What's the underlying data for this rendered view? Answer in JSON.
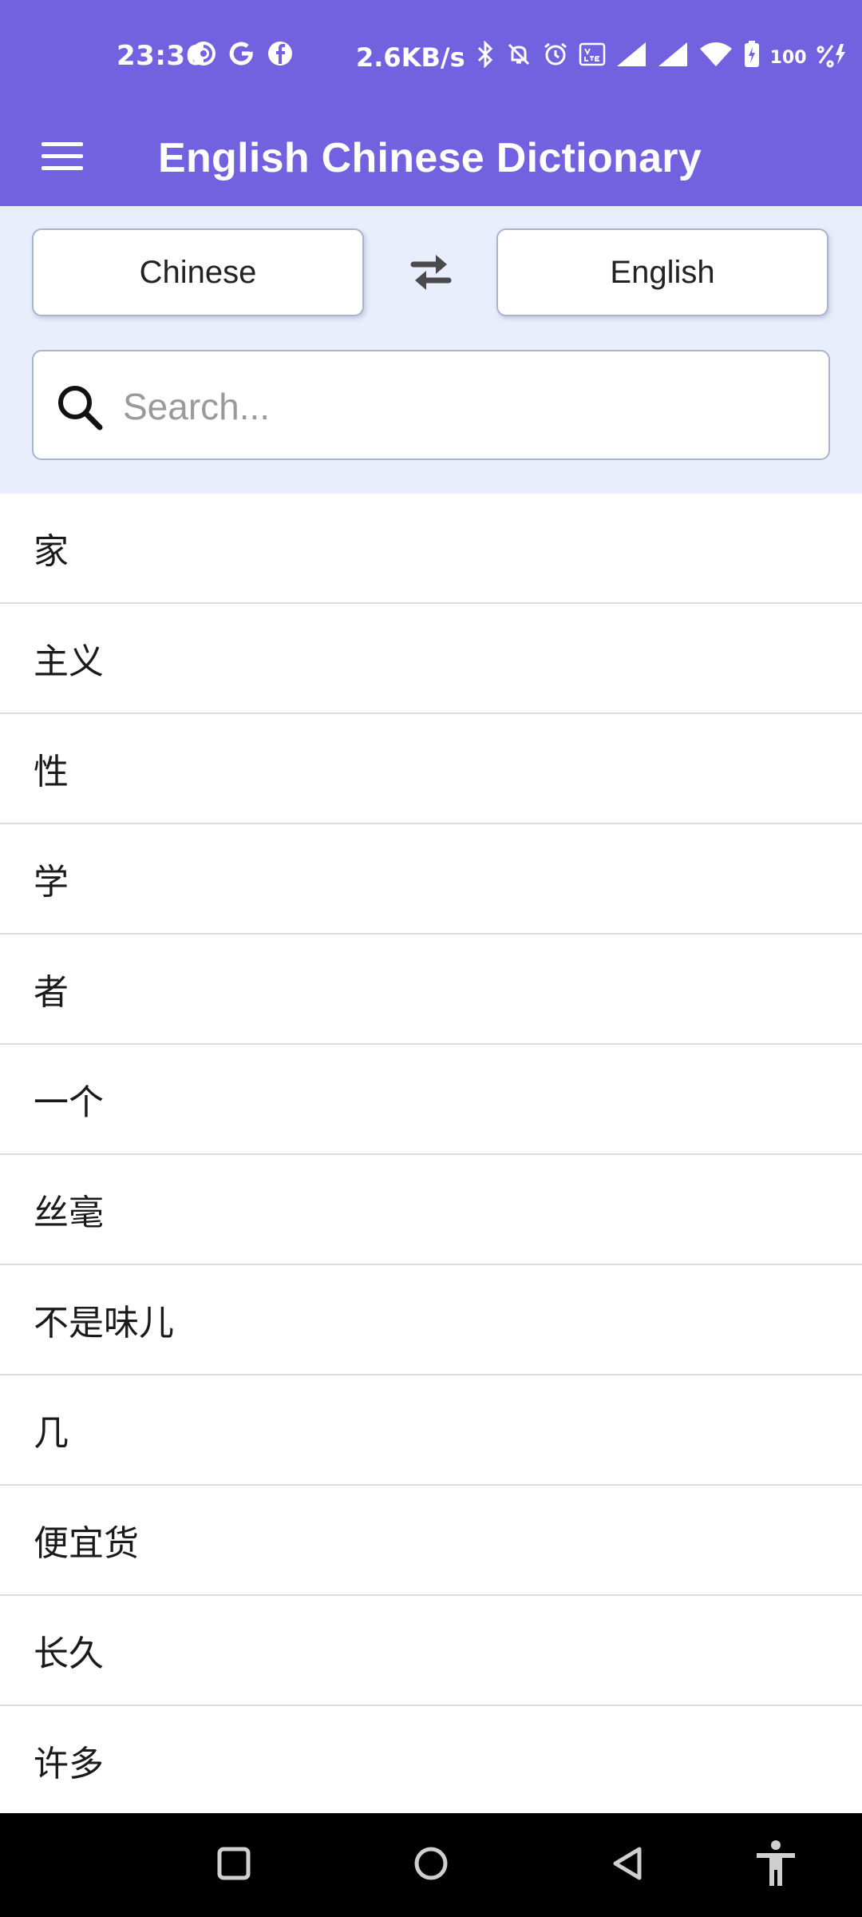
{
  "status_bar": {
    "time": "23:36",
    "net_speed": "2.6KB/s",
    "battery": "100",
    "left_icons": [
      "pocket-casts-icon",
      "google-icon",
      "facebook-icon"
    ],
    "right_icons": [
      "bluetooth-icon",
      "mute-icon",
      "alarm-icon",
      "volte-icon",
      "signal-icon",
      "signal-icon",
      "wifi-icon",
      "battery-charging-icon",
      "speed-icon"
    ]
  },
  "app_bar": {
    "title": "English Chinese Dictionary",
    "menu_icon": "hamburger-menu-icon",
    "color": "#7362E0"
  },
  "language": {
    "from": "Chinese",
    "to": "English",
    "swap_icon": "swap-arrows-icon"
  },
  "search": {
    "placeholder": "Search...",
    "value": ""
  },
  "words": [
    "家",
    "主义",
    "性",
    "学",
    "者",
    "一个",
    "丝毫",
    "不是味儿",
    "几",
    "便宜货",
    "长久",
    "许多"
  ],
  "nav_bar": {
    "icons": [
      "recents-icon",
      "home-icon",
      "back-icon",
      "accessibility-icon"
    ]
  }
}
